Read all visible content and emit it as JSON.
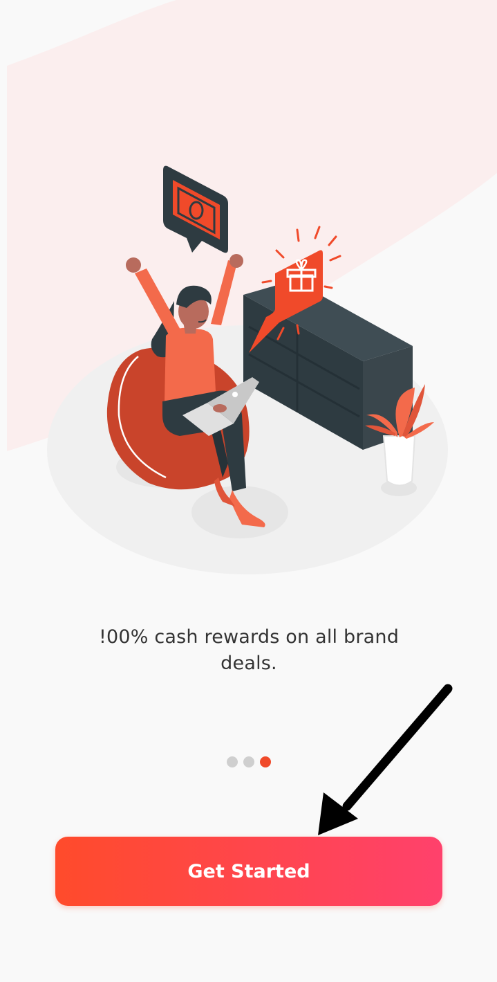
{
  "onboarding": {
    "caption": "!00% cash rewards on all brand deals.",
    "pager": {
      "count": 3,
      "active_index": 2
    },
    "cta_label": "Get Started"
  },
  "colors": {
    "accent": "#f04a2a",
    "button_gradient_start": "#ff4b2b",
    "button_gradient_end": "#ff416c",
    "background": "#f9f9f9",
    "bg_blob": "#fbeeee",
    "dot_inactive": "#cfcfcf"
  },
  "icons": {
    "illustration": "woman-celebrating-rewards-illustration",
    "money_bubble": "cash-chat-bubble-icon",
    "gift_bubble": "gift-chat-bubble-icon",
    "annotation": "arrow-pointer-icon"
  }
}
